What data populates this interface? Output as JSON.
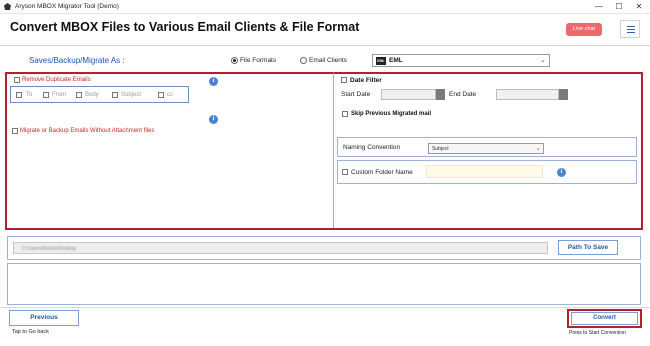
{
  "window": {
    "title": "Aryson MBOX Migrator Tool (Demo)",
    "minimize": "—",
    "maximize": "☐",
    "close": "✕"
  },
  "header": {
    "title": "Convert MBOX Files to Various Email Clients & File Format",
    "live_chat": "Live chat"
  },
  "saves": {
    "label": "Saves/Backup/Migrate As :",
    "option_file_formats": "File Formats",
    "option_email_clients": "Email Clients",
    "selected_format": "EML",
    "format_icon_text": "EML"
  },
  "left_panel": {
    "remove_duplicates": "Remove Duplicate Emails",
    "dup_fields": [
      "To",
      "From",
      "Body",
      "Subject",
      "cc"
    ],
    "migrate_without_attachments": "Migrate or Backup Emails Without Attachment files",
    "info_glyph": "i"
  },
  "right_panel": {
    "date_filter": "Date Filter",
    "start_date": "Start Date",
    "end_date": "End Date",
    "skip_previous": "Skip Previous Migrated mail",
    "naming_convention": "Naming Convention",
    "naming_value": "Subject",
    "custom_folder": "Custom Folder Name"
  },
  "destination": {
    "path_value": "C:\\Users\\Kelvin\\Desktop",
    "path_button": "Path To Save"
  },
  "footer": {
    "previous": "Previous",
    "previous_hint": "Tap to Go back",
    "convert": "Convert",
    "convert_hint": "Press to Start Conversion"
  }
}
